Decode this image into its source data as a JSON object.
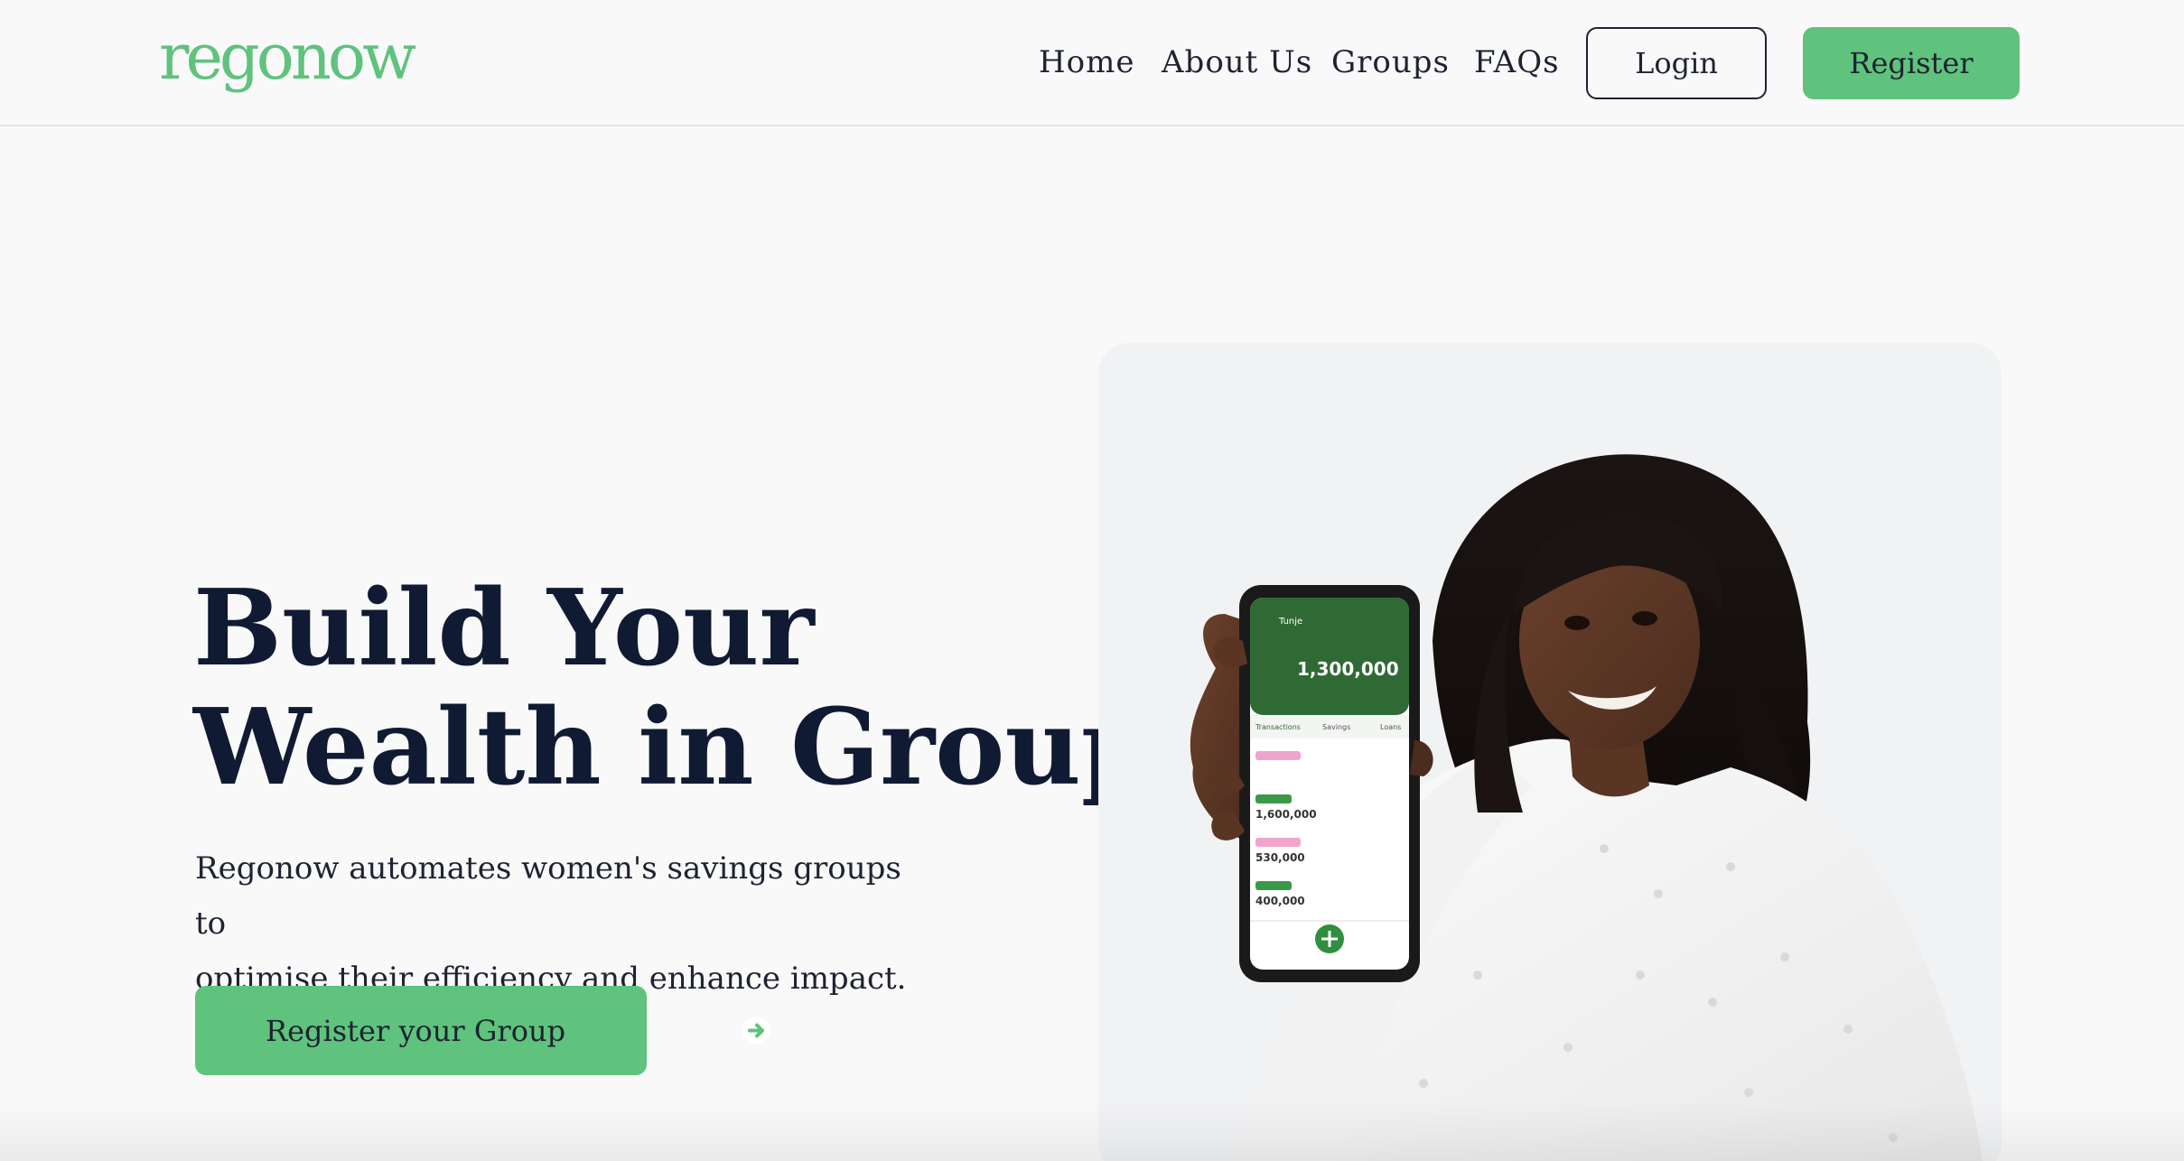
{
  "brand": {
    "logo_text": "regonow",
    "accent_color": "#5fc27d",
    "heading_color": "#101a33"
  },
  "nav": {
    "links": [
      "Home",
      "About Us",
      "Groups",
      "FAQs"
    ],
    "login_label": "Login",
    "register_label": "Register"
  },
  "hero": {
    "title_line1": "Build Your",
    "title_line2": "Wealth in Groups",
    "subtitle_line1": "Regonow automates women's savings groups to",
    "subtitle_line2": "optimise their efficiency and enhance impact.",
    "cta_label": "Register your Group",
    "cta_icon": "arrow-right-circle-icon"
  },
  "phone_screen": {
    "group_name": "Tunje",
    "total_savings": "1,300,000",
    "tabs": [
      "Transactions",
      "Savings",
      "Loans"
    ],
    "amounts": [
      "1,600,000",
      "530,000",
      "400,000"
    ]
  }
}
